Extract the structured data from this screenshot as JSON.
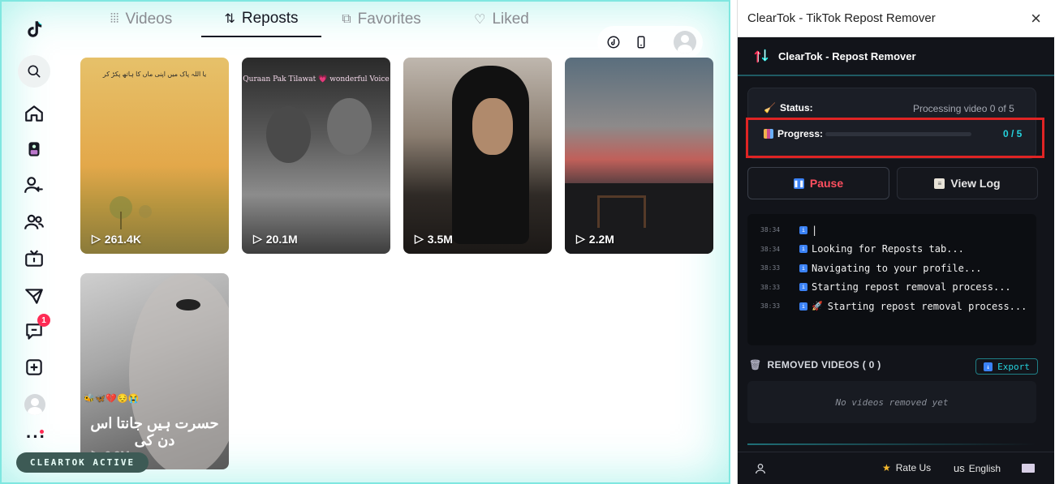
{
  "tiktok": {
    "tabs": [
      {
        "label": "Videos",
        "icon": "grid-icon"
      },
      {
        "label": "Reposts",
        "icon": "repost-icon"
      },
      {
        "label": "Favorites",
        "icon": "bookmark-icon"
      },
      {
        "label": "Liked",
        "icon": "heart-icon"
      }
    ],
    "active_tab": "Reposts",
    "nav_badge_count": "1",
    "videos": [
      {
        "views": "261.4K",
        "caption": "یا اللہ پاک میں اپنی ماں کا ہاتھ پکڑ کر"
      },
      {
        "views": "20.1M",
        "caption": "Quraan Pak Tilawat 💗 wonderful Voice"
      },
      {
        "views": "3.5M",
        "caption": ""
      },
      {
        "views": "2.2M",
        "caption": ""
      },
      {
        "views": "6.9M",
        "caption": "حسرت ہیں جانتا اس دن کی"
      }
    ],
    "status_pill": "CLEARTOK ACTIVE"
  },
  "panel": {
    "window_title": "ClearTok - TikTok Repost Remover",
    "header_title": "ClearTok - Repost Remover",
    "status_label": "Status:",
    "status_value": "Processing video 0 of 5",
    "progress_label": "Progress:",
    "progress_value": "0 / 5",
    "progress_fraction": 0,
    "pause_label": "Pause",
    "view_log_label": "View Log",
    "log": [
      {
        "time": "38:34",
        "msg": "|"
      },
      {
        "time": "38:34",
        "msg": "Looking for Reposts tab..."
      },
      {
        "time": "38:33",
        "msg": "Navigating to your profile..."
      },
      {
        "time": "38:33",
        "msg": "Starting repost removal process..."
      },
      {
        "time": "38:33",
        "msg": "Starting repost removal process..."
      }
    ],
    "removed_title": "REMOVED VIDEOS ( 0 )",
    "export_label": "Export",
    "removed_empty": "No videos removed yet",
    "footer": {
      "rate": "Rate Us",
      "lang_code": "us",
      "lang": "English"
    }
  },
  "colors": {
    "accent": "#25f4ee",
    "danger": "#fe2c55",
    "highlight": "#e02424"
  }
}
